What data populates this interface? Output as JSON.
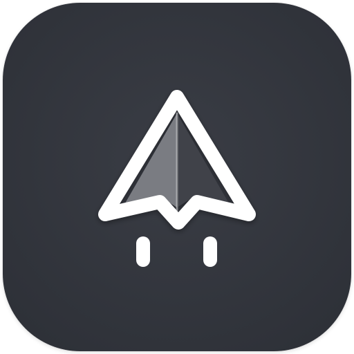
{
  "icon": {
    "name": "paper-plane-launch-icon",
    "colors": {
      "background": "#3a3d45",
      "background_edge": "#2d3037",
      "stroke": "#ffffff",
      "fill_left_face": "#7a7c82",
      "fill_right_face": "#3f4249"
    }
  }
}
